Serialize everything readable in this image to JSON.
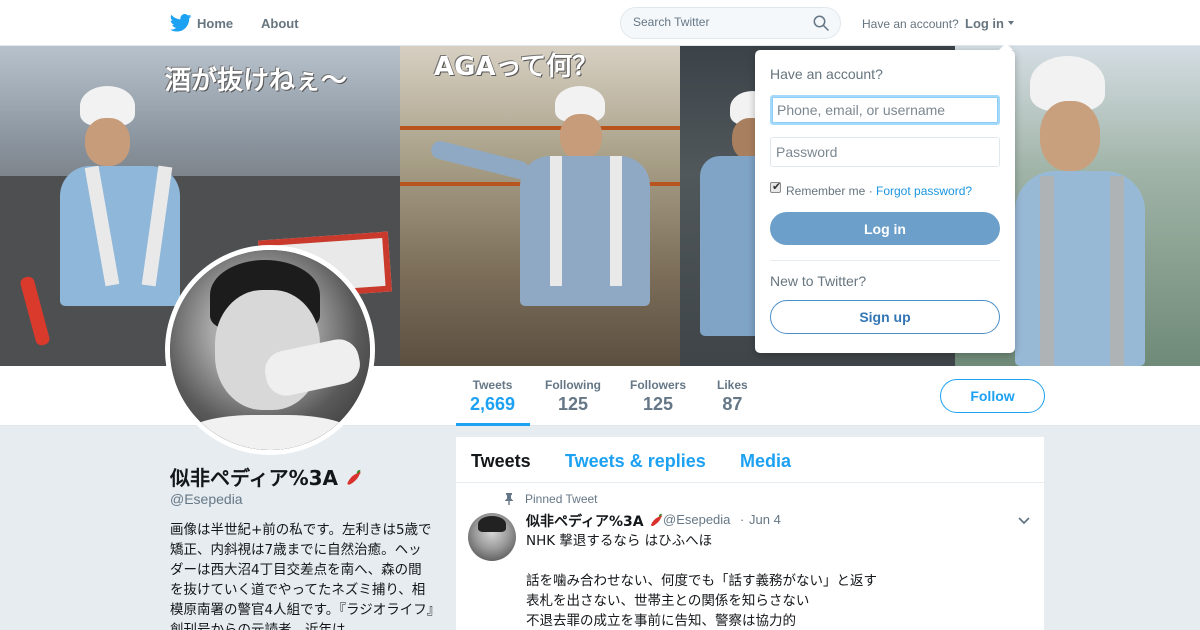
{
  "topnav": {
    "home_label": "Home",
    "about_label": "About",
    "search_placeholder": "Search Twitter",
    "have_account": "Have an account?",
    "login_label": "Log in"
  },
  "header_image": {
    "captions": [
      "酒が抜けねぇ〜",
      "AGAって何？"
    ]
  },
  "profile_nav": {
    "stats": [
      {
        "label": "Tweets",
        "value": "2,669",
        "active": true
      },
      {
        "label": "Following",
        "value": "125",
        "active": false
      },
      {
        "label": "Followers",
        "value": "125",
        "active": false
      },
      {
        "label": "Likes",
        "value": "87",
        "active": false
      }
    ],
    "follow_label": "Follow"
  },
  "profile": {
    "name": "似非ペディア%3A",
    "screen_name": "@Esepedia",
    "bio": "画像は半世紀+前の私です。左利きは5歳で矯正、内斜視は7歳までに自然治癒。ヘッダーは西大沼4丁目交差点を南へ、森の間を抜けていく道でやってたネズミ捕り、相模原南署の警官4人組です。『ラジオライフ』創刊号からの元読者。近年は"
  },
  "timeline": {
    "tabs": [
      "Tweets",
      "Tweets & replies",
      "Media"
    ],
    "pinned_label": "Pinned Tweet",
    "tweet": {
      "name": "似非ペディア%3A",
      "screen_name": "@Esepedia",
      "dot": "·",
      "date": "Jun 4",
      "text": "NHK 撃退するなら はひふへほ\n\n話を噛み合わせない、何度でも「話す義務がない」と返す\n表札を出さない、世帯主との関係を知らさない\n不退去罪の成立を事前に告知、警察は協力的"
    }
  },
  "login_dropdown": {
    "title": "Have an account?",
    "username_placeholder": "Phone, email, or username",
    "password_placeholder": "Password",
    "remember_label": "Remember me",
    "separator": "·",
    "forgot_label": "Forgot password?",
    "login_button": "Log in",
    "new_label": "New to Twitter?",
    "signup_button": "Sign up"
  },
  "colors": {
    "brand_blue": "#1da1f2",
    "login_button": "#6c9fc9",
    "text_gray": "#657786"
  }
}
